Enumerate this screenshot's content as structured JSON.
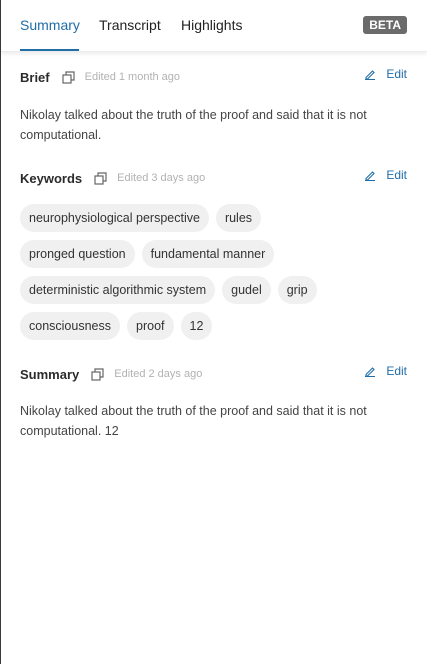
{
  "tabs": [
    {
      "label": "Summary",
      "active": true
    },
    {
      "label": "Transcript",
      "active": false
    },
    {
      "label": "Highlights",
      "active": false
    }
  ],
  "badge": "BETA",
  "colors": {
    "accent": "#1f6ea8",
    "chip_bg": "#f0f0f0",
    "badge_bg": "#6b6b6b"
  },
  "brief": {
    "title": "Brief",
    "edited": "Edited 1 month ago",
    "edit_label": "Edit",
    "text": "Nikolay talked about the truth of the proof and said that it is not computational."
  },
  "keywords": {
    "title": "Keywords",
    "edited": "Edited 3 days ago",
    "edit_label": "Edit",
    "items": [
      "neurophysiological perspective",
      "rules",
      "pronged question",
      "fundamental manner",
      "deterministic algorithmic system",
      "gudel",
      "grip",
      "consciousness",
      "proof",
      "12"
    ]
  },
  "summary": {
    "title": "Summary",
    "edited": "Edited 2 days ago",
    "edit_label": "Edit",
    "text": "Nikolay talked about the truth of the proof and said that it is not computational. 12"
  }
}
